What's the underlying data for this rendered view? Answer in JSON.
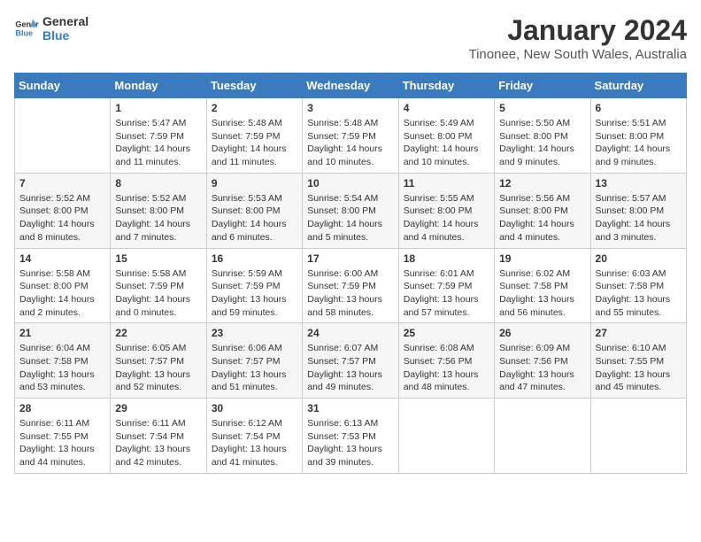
{
  "header": {
    "logo_line1": "General",
    "logo_line2": "Blue",
    "month_year": "January 2024",
    "location": "Tinonee, New South Wales, Australia"
  },
  "days_of_week": [
    "Sunday",
    "Monday",
    "Tuesday",
    "Wednesday",
    "Thursday",
    "Friday",
    "Saturday"
  ],
  "weeks": [
    [
      {
        "day": "",
        "info": ""
      },
      {
        "day": "1",
        "info": "Sunrise: 5:47 AM\nSunset: 7:59 PM\nDaylight: 14 hours\nand 11 minutes."
      },
      {
        "day": "2",
        "info": "Sunrise: 5:48 AM\nSunset: 7:59 PM\nDaylight: 14 hours\nand 11 minutes."
      },
      {
        "day": "3",
        "info": "Sunrise: 5:48 AM\nSunset: 7:59 PM\nDaylight: 14 hours\nand 10 minutes."
      },
      {
        "day": "4",
        "info": "Sunrise: 5:49 AM\nSunset: 8:00 PM\nDaylight: 14 hours\nand 10 minutes."
      },
      {
        "day": "5",
        "info": "Sunrise: 5:50 AM\nSunset: 8:00 PM\nDaylight: 14 hours\nand 9 minutes."
      },
      {
        "day": "6",
        "info": "Sunrise: 5:51 AM\nSunset: 8:00 PM\nDaylight: 14 hours\nand 9 minutes."
      }
    ],
    [
      {
        "day": "7",
        "info": "Sunrise: 5:52 AM\nSunset: 8:00 PM\nDaylight: 14 hours\nand 8 minutes."
      },
      {
        "day": "8",
        "info": "Sunrise: 5:52 AM\nSunset: 8:00 PM\nDaylight: 14 hours\nand 7 minutes."
      },
      {
        "day": "9",
        "info": "Sunrise: 5:53 AM\nSunset: 8:00 PM\nDaylight: 14 hours\nand 6 minutes."
      },
      {
        "day": "10",
        "info": "Sunrise: 5:54 AM\nSunset: 8:00 PM\nDaylight: 14 hours\nand 5 minutes."
      },
      {
        "day": "11",
        "info": "Sunrise: 5:55 AM\nSunset: 8:00 PM\nDaylight: 14 hours\nand 4 minutes."
      },
      {
        "day": "12",
        "info": "Sunrise: 5:56 AM\nSunset: 8:00 PM\nDaylight: 14 hours\nand 4 minutes."
      },
      {
        "day": "13",
        "info": "Sunrise: 5:57 AM\nSunset: 8:00 PM\nDaylight: 14 hours\nand 3 minutes."
      }
    ],
    [
      {
        "day": "14",
        "info": "Sunrise: 5:58 AM\nSunset: 8:00 PM\nDaylight: 14 hours\nand 2 minutes."
      },
      {
        "day": "15",
        "info": "Sunrise: 5:58 AM\nSunset: 7:59 PM\nDaylight: 14 hours\nand 0 minutes."
      },
      {
        "day": "16",
        "info": "Sunrise: 5:59 AM\nSunset: 7:59 PM\nDaylight: 13 hours\nand 59 minutes."
      },
      {
        "day": "17",
        "info": "Sunrise: 6:00 AM\nSunset: 7:59 PM\nDaylight: 13 hours\nand 58 minutes."
      },
      {
        "day": "18",
        "info": "Sunrise: 6:01 AM\nSunset: 7:59 PM\nDaylight: 13 hours\nand 57 minutes."
      },
      {
        "day": "19",
        "info": "Sunrise: 6:02 AM\nSunset: 7:58 PM\nDaylight: 13 hours\nand 56 minutes."
      },
      {
        "day": "20",
        "info": "Sunrise: 6:03 AM\nSunset: 7:58 PM\nDaylight: 13 hours\nand 55 minutes."
      }
    ],
    [
      {
        "day": "21",
        "info": "Sunrise: 6:04 AM\nSunset: 7:58 PM\nDaylight: 13 hours\nand 53 minutes."
      },
      {
        "day": "22",
        "info": "Sunrise: 6:05 AM\nSunset: 7:57 PM\nDaylight: 13 hours\nand 52 minutes."
      },
      {
        "day": "23",
        "info": "Sunrise: 6:06 AM\nSunset: 7:57 PM\nDaylight: 13 hours\nand 51 minutes."
      },
      {
        "day": "24",
        "info": "Sunrise: 6:07 AM\nSunset: 7:57 PM\nDaylight: 13 hours\nand 49 minutes."
      },
      {
        "day": "25",
        "info": "Sunrise: 6:08 AM\nSunset: 7:56 PM\nDaylight: 13 hours\nand 48 minutes."
      },
      {
        "day": "26",
        "info": "Sunrise: 6:09 AM\nSunset: 7:56 PM\nDaylight: 13 hours\nand 47 minutes."
      },
      {
        "day": "27",
        "info": "Sunrise: 6:10 AM\nSunset: 7:55 PM\nDaylight: 13 hours\nand 45 minutes."
      }
    ],
    [
      {
        "day": "28",
        "info": "Sunrise: 6:11 AM\nSunset: 7:55 PM\nDaylight: 13 hours\nand 44 minutes."
      },
      {
        "day": "29",
        "info": "Sunrise: 6:11 AM\nSunset: 7:54 PM\nDaylight: 13 hours\nand 42 minutes."
      },
      {
        "day": "30",
        "info": "Sunrise: 6:12 AM\nSunset: 7:54 PM\nDaylight: 13 hours\nand 41 minutes."
      },
      {
        "day": "31",
        "info": "Sunrise: 6:13 AM\nSunset: 7:53 PM\nDaylight: 13 hours\nand 39 minutes."
      },
      {
        "day": "",
        "info": ""
      },
      {
        "day": "",
        "info": ""
      },
      {
        "day": "",
        "info": ""
      }
    ]
  ]
}
